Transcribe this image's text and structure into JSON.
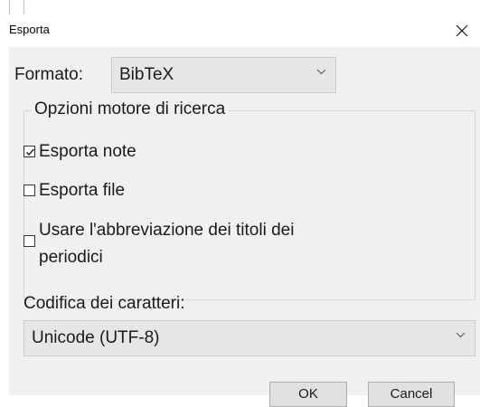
{
  "dialog": {
    "title": "Esporta",
    "format": {
      "label": "Formato:",
      "selected": "BibTeX"
    },
    "options_group": {
      "title": "Opzioni motore di ricerca",
      "options": [
        {
          "label": "Esporta note",
          "checked": true
        },
        {
          "label": "Esporta file",
          "checked": false
        },
        {
          "label_line1": "Usare l'abbreviazione dei titoli dei",
          "label_line2": "periodici",
          "checked": false
        }
      ]
    },
    "encoding": {
      "label": "Codifica dei caratteri:",
      "selected": "Unicode (UTF-8)"
    },
    "buttons": {
      "ok": "OK",
      "cancel": "Cancel"
    }
  },
  "icons": {
    "close": "close-icon",
    "dropdown": "chevron-down-icon",
    "checkmark": "checkmark-icon"
  }
}
